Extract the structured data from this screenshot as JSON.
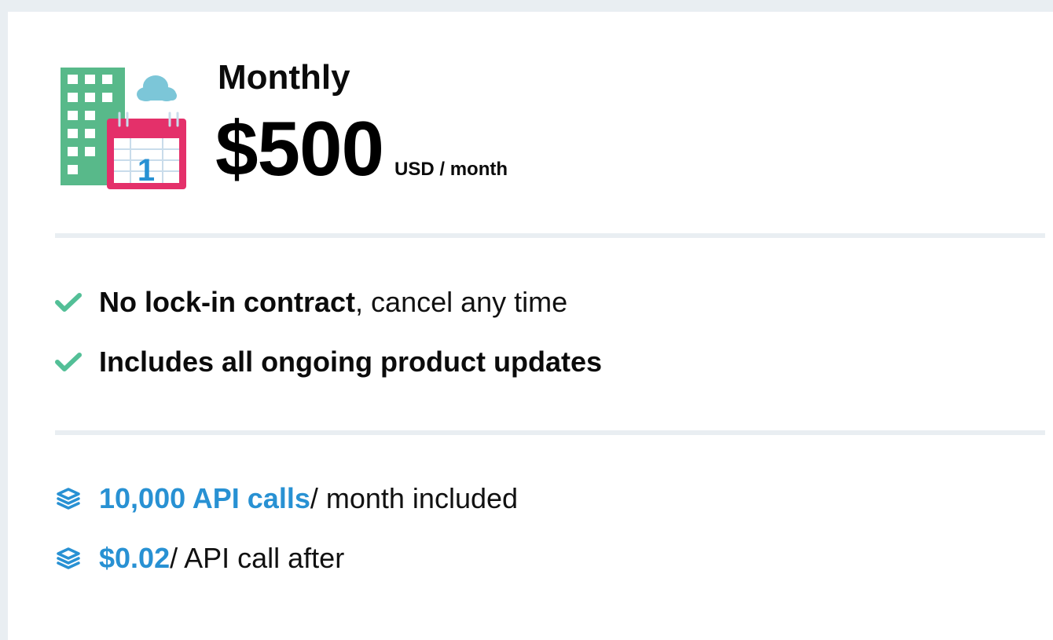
{
  "plan": {
    "name": "Monthly",
    "price": "$500",
    "period": "USD / month"
  },
  "features": [
    {
      "icon": "check-icon",
      "strong": "No lock-in contract",
      "rest": ", cancel any time"
    },
    {
      "icon": "check-icon",
      "strong": "Includes all ongoing product updates",
      "rest": ""
    }
  ],
  "usage": [
    {
      "icon": "layers-icon",
      "highlight": "10,000 API calls",
      "rest": " / month included"
    },
    {
      "icon": "layers-icon",
      "highlight": "$0.02",
      "rest": " / API call after"
    }
  ],
  "illustration": {
    "calendar_day": "1",
    "icons": [
      "building-icon",
      "cloud-icon",
      "calendar-icon"
    ]
  },
  "colors": {
    "check": "#53bf97",
    "accent": "#2891d3",
    "building": "#58b98a",
    "cloud": "#7cc6d8",
    "calendar": "#e4306a",
    "divider": "#e9eef2"
  }
}
